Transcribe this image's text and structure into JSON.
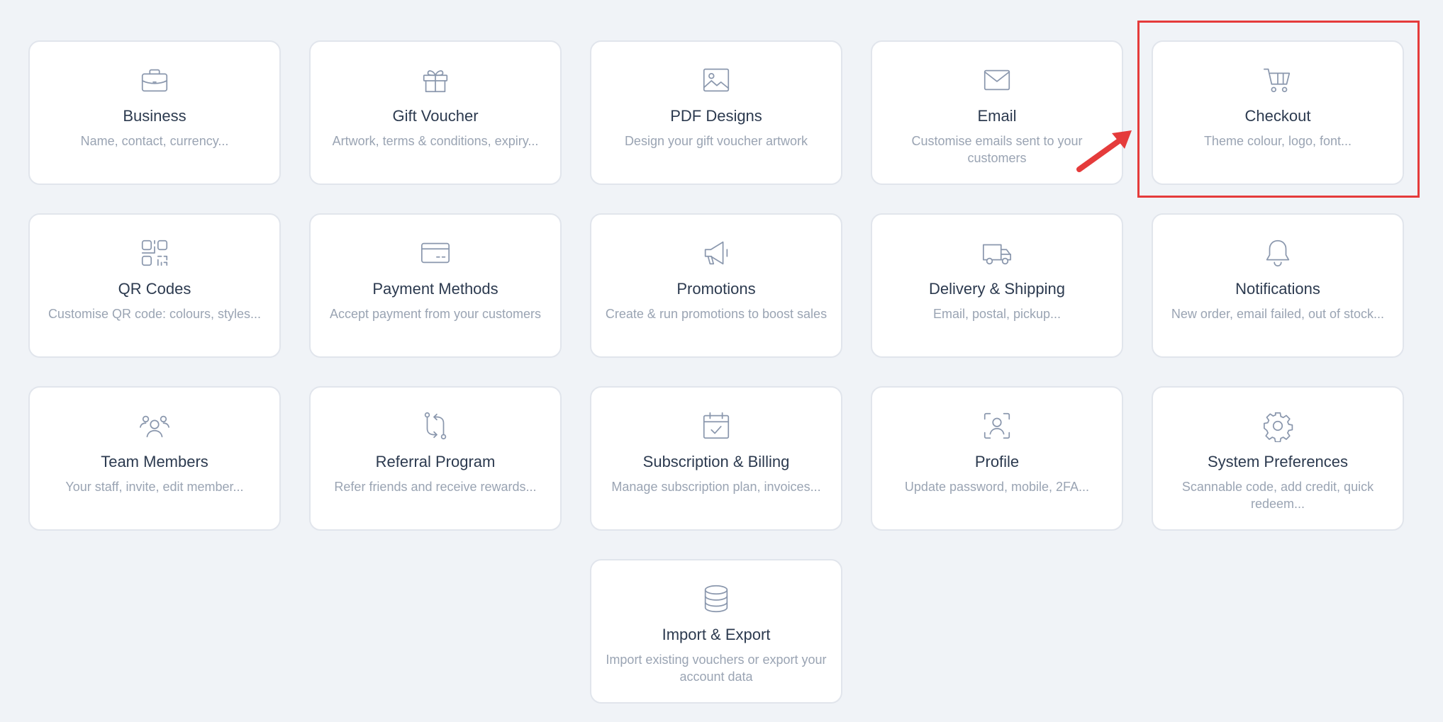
{
  "settings": {
    "cards": [
      {
        "title": "Business",
        "description": "Name, contact, currency...",
        "icon": "briefcase-icon"
      },
      {
        "title": "Gift Voucher",
        "description": "Artwork, terms & conditions, expiry...",
        "icon": "gift-icon"
      },
      {
        "title": "PDF Designs",
        "description": "Design your gift voucher artwork",
        "icon": "image-icon"
      },
      {
        "title": "Email",
        "description": "Customise emails sent to your customers",
        "icon": "envelope-icon"
      },
      {
        "title": "Checkout",
        "description": "Theme colour, logo, font...",
        "icon": "cart-icon"
      },
      {
        "title": "QR Codes",
        "description": "Customise QR code: colours, styles...",
        "icon": "qr-code-icon"
      },
      {
        "title": "Payment Methods",
        "description": "Accept payment from your customers",
        "icon": "credit-card-icon"
      },
      {
        "title": "Promotions",
        "description": "Create & run promotions to boost sales",
        "icon": "megaphone-icon"
      },
      {
        "title": "Delivery & Shipping",
        "description": "Email, postal, pickup...",
        "icon": "truck-icon"
      },
      {
        "title": "Notifications",
        "description": "New order, email failed, out of stock...",
        "icon": "bell-icon"
      },
      {
        "title": "Team Members",
        "description": "Your staff, invite, edit member...",
        "icon": "users-icon"
      },
      {
        "title": "Referral Program",
        "description": "Refer friends and receive rewards...",
        "icon": "exchange-icon"
      },
      {
        "title": "Subscription & Billing",
        "description": "Manage subscription plan, invoices...",
        "icon": "calendar-check-icon"
      },
      {
        "title": "Profile",
        "description": "Update password, mobile, 2FA...",
        "icon": "user-scan-icon"
      },
      {
        "title": "System Preferences",
        "description": "Scannable code, add credit, quick redeem...",
        "icon": "gear-icon"
      },
      {
        "title": "Import & Export",
        "description": "Import existing vouchers or export your account data",
        "icon": "database-icon"
      }
    ]
  },
  "annotation": {
    "highlighted_card": "Checkout",
    "color": "#e53b3b"
  },
  "colors": {
    "background": "#f0f3f7",
    "card_border": "#e1e5ec",
    "icon": "#8a97ad",
    "title": "#2c3a4f",
    "description": "#9aa4b3"
  }
}
